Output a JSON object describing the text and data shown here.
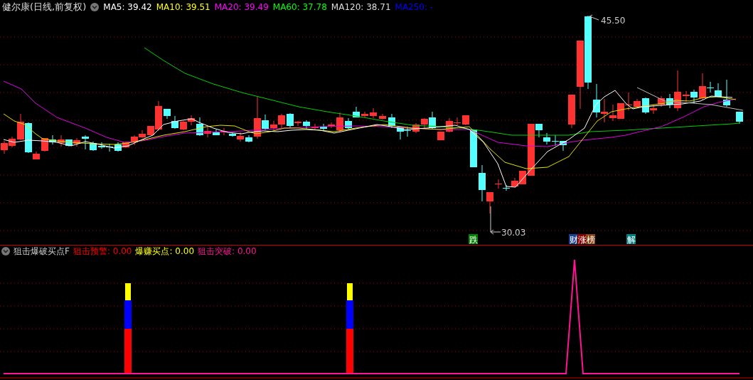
{
  "header": {
    "title": "健尔康(日线,前复权)",
    "indicators": [
      {
        "text": "MA5: 39.42",
        "color": "#ffffff"
      },
      {
        "text": "MA10: 39.51",
        "color": "#ffff00"
      },
      {
        "text": "MA20: 39.49",
        "color": "#ff00ff"
      },
      {
        "text": "MA60: 37.78",
        "color": "#00ff00"
      },
      {
        "text": "MA120: 38.71",
        "color": "#dddddd"
      },
      {
        "text": "MA250: -",
        "color": "#0000ff"
      }
    ]
  },
  "price_chart": {
    "high_label": "45.50",
    "low_label": "30.03",
    "tags": [
      {
        "text": "跌",
        "color": "#008000"
      },
      {
        "text": "财",
        "color": "#1c3f94"
      },
      {
        "text": "涨",
        "color": "#8b0000"
      },
      {
        "text": "榜",
        "color": "#8b4513"
      },
      {
        "text": "解",
        "color": "#008080"
      }
    ]
  },
  "indicator_panel": {
    "name": "狙击爆破买点F",
    "values": [
      {
        "text": "狙击预警: 0.00",
        "color": "#ff0000"
      },
      {
        "text": "爆赚买点: 0.00",
        "color": "#ffff00"
      },
      {
        "text": "狙击突破: 0.00",
        "color": "#ff1493"
      }
    ]
  }
}
